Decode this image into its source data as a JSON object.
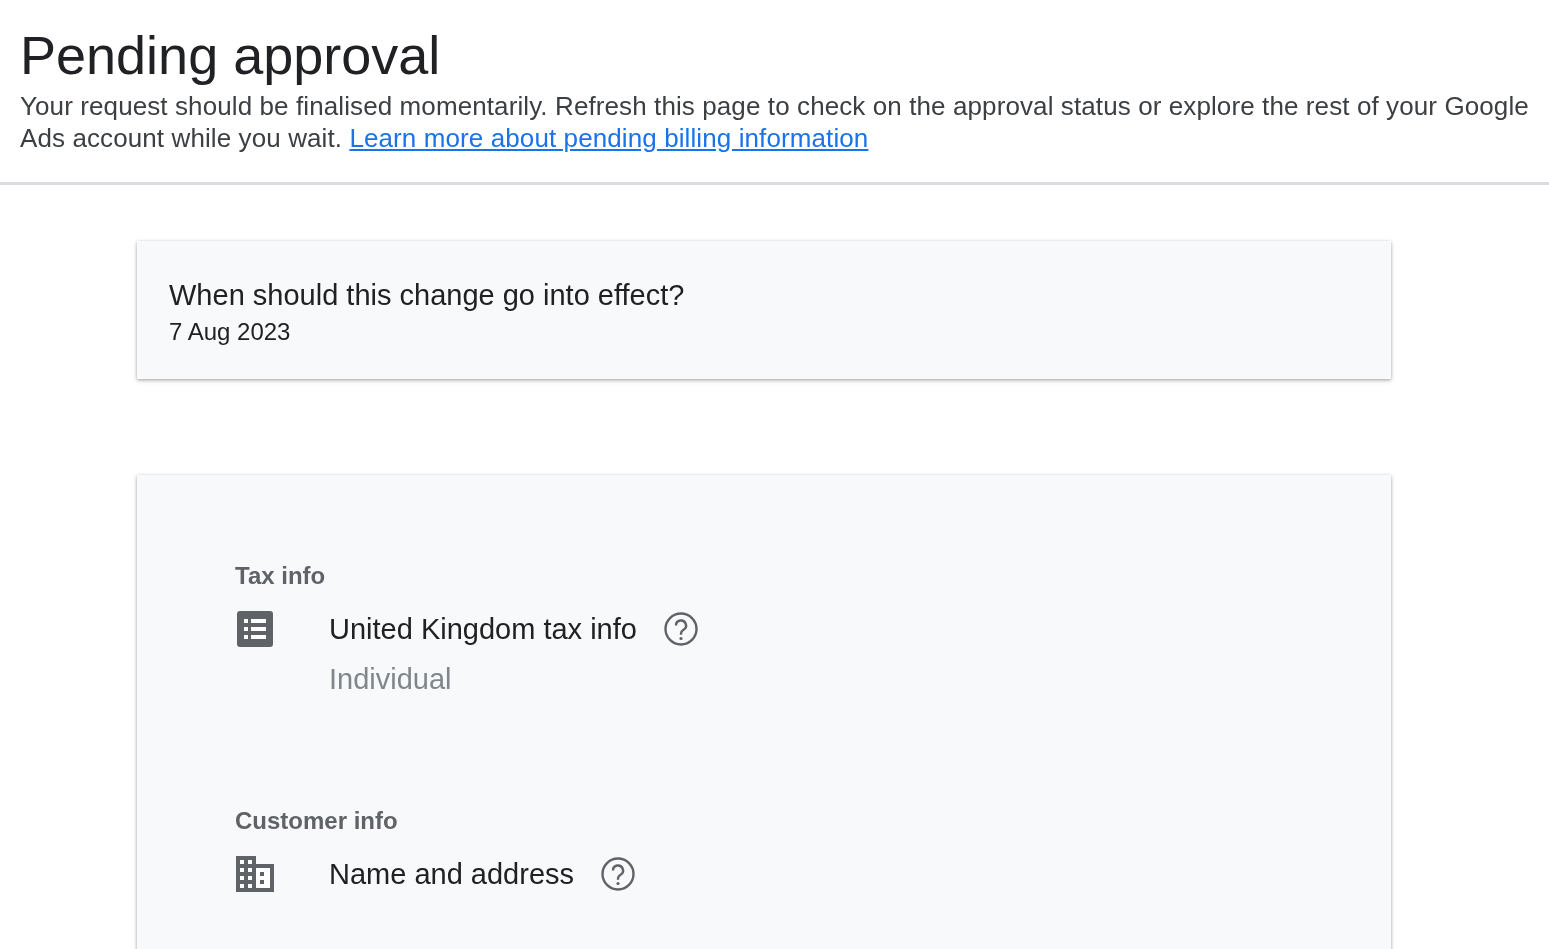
{
  "header": {
    "title": "Pending approval",
    "description": "Your request should be finalised momentarily. Refresh this page to check on the approval status or explore the rest of your Google Ads account while you wait.",
    "link": "Learn more about pending billing information"
  },
  "effective_date": {
    "question": "When should this change go into effect?",
    "date": "7 Aug 2023"
  },
  "sections": [
    {
      "heading": "Tax info",
      "items": [
        {
          "kind": "tax",
          "label": "United Kingdom tax info",
          "value": "Individual"
        }
      ]
    },
    {
      "heading": "Customer info",
      "items": [
        {
          "kind": "address",
          "label": "Name and address"
        }
      ]
    }
  ]
}
